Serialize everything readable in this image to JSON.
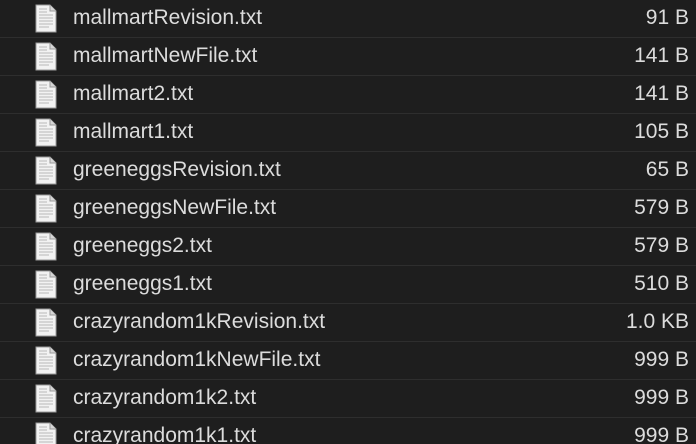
{
  "file_list": {
    "rows": [
      {
        "name": "mallmartRevision.txt",
        "size": "91 B",
        "icon": "text-document-icon"
      },
      {
        "name": "mallmartNewFile.txt",
        "size": "141 B",
        "icon": "text-document-icon"
      },
      {
        "name": "mallmart2.txt",
        "size": "141 B",
        "icon": "text-document-icon"
      },
      {
        "name": "mallmart1.txt",
        "size": "105 B",
        "icon": "text-document-icon"
      },
      {
        "name": "greeneggsRevision.txt",
        "size": "65 B",
        "icon": "text-document-icon"
      },
      {
        "name": "greeneggsNewFile.txt",
        "size": "579 B",
        "icon": "text-document-icon"
      },
      {
        "name": "greeneggs2.txt",
        "size": "579 B",
        "icon": "text-document-icon"
      },
      {
        "name": "greeneggs1.txt",
        "size": "510 B",
        "icon": "text-document-icon"
      },
      {
        "name": "crazyrandom1kRevision.txt",
        "size": "1.0 KB",
        "icon": "text-document-icon"
      },
      {
        "name": "crazyrandom1kNewFile.txt",
        "size": "999 B",
        "icon": "text-document-icon"
      },
      {
        "name": "crazyrandom1k2.txt",
        "size": "999 B",
        "icon": "text-document-icon"
      },
      {
        "name": "crazyrandom1k1.txt",
        "size": "999 B",
        "icon": "text-document-icon"
      }
    ]
  },
  "colors": {
    "background": "#1e1e1e",
    "text": "#dcdcdc",
    "separator": "#2e2e2e"
  }
}
